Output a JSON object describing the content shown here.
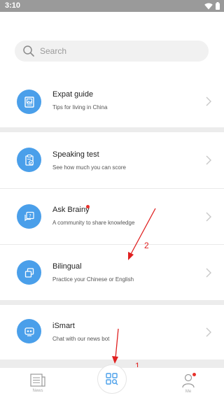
{
  "status_bar": {
    "time": "3:10"
  },
  "search": {
    "placeholder": "Search"
  },
  "items": [
    {
      "title": "Expat guide",
      "subtitle": "Tips for living in China",
      "icon": "picture-book-icon"
    },
    {
      "title": "Speaking test",
      "subtitle": "See how much you can score",
      "icon": "clipboard-check-icon"
    },
    {
      "title": "Ask Brainy",
      "subtitle": "A community to share knowledge",
      "icon": "question-chat-icon",
      "badge": true
    },
    {
      "title": "Bilingual",
      "subtitle": "Practice your Chinese or English",
      "icon": "overlapping-squares-icon"
    },
    {
      "title": "iSmart",
      "subtitle": "Chat with our news bot",
      "icon": "robot-icon"
    }
  ],
  "annotations": {
    "first": "1",
    "second": "2"
  },
  "tab_bar": {
    "news_label": "News",
    "me_label": "Me"
  },
  "colors": {
    "accent": "#4a9fea",
    "badge": "#e8312b",
    "annotation": "#e02020"
  }
}
